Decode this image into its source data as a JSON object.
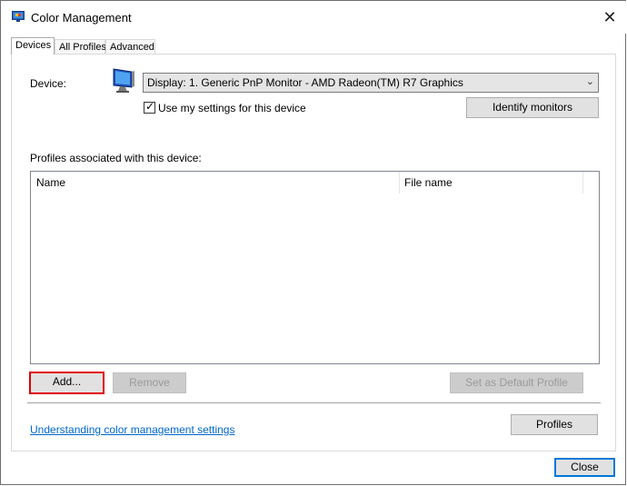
{
  "window": {
    "title": "Color Management",
    "icon": "color-management-icon",
    "close_glyph": "✕"
  },
  "tabs": [
    {
      "label": "Devices",
      "active": true
    },
    {
      "label": "All Profiles",
      "active": false
    },
    {
      "label": "Advanced",
      "active": false
    }
  ],
  "devices": {
    "device_label": "Device:",
    "device_value": "Display: 1. Generic PnP Monitor - AMD Radeon(TM) R7 Graphics",
    "use_settings_label": "Use my settings for this device",
    "use_settings_checked": true,
    "identify_label": "Identify monitors",
    "profiles_label": "Profiles associated with this device:",
    "columns": [
      "Name",
      "File name"
    ],
    "add_label": "Add...",
    "remove_label": "Remove",
    "set_default_label": "Set as Default Profile",
    "link_label": "Understanding color management settings",
    "profiles_button_label": "Profiles"
  },
  "footer": {
    "close_label": "Close"
  },
  "colors": {
    "accent": "#0078d7",
    "highlight": "#e00000",
    "link": "#0066cc"
  }
}
